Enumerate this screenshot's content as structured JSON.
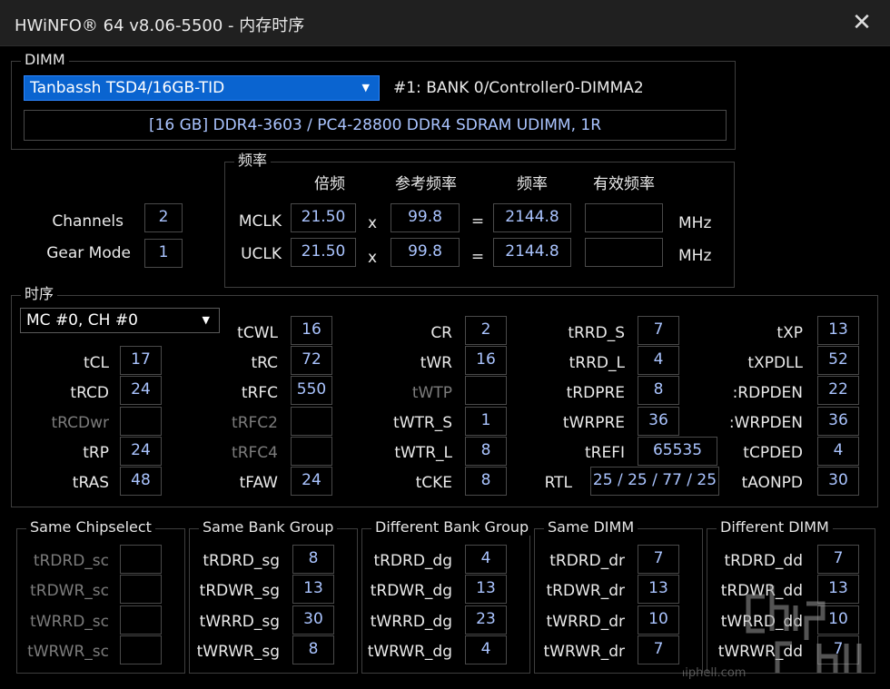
{
  "window": {
    "title": "HWiNFO® 64 v8.06-5500 - 内存时序"
  },
  "dimm": {
    "legend": "DIMM",
    "selected": "Tanbassh TSD4/16GB-TID",
    "location": "#1: BANK 0/Controller0-DIMMA2",
    "description": "[16 GB] DDR4-3603 / PC4-28800 DDR4 SDRAM UDIMM, 1R"
  },
  "freq": {
    "legend": "频率",
    "col_multiplier": "倍频",
    "col_ref": "参考频率",
    "col_freq": "频率",
    "col_effective": "有效频率",
    "times": "x",
    "equals": "=",
    "unit": "MHz",
    "rows": [
      {
        "label": "MCLK",
        "multiplier": "21.50",
        "ref": "99.8",
        "freq": "2144.8",
        "effective": ""
      },
      {
        "label": "UCLK",
        "multiplier": "21.50",
        "ref": "99.8",
        "freq": "2144.8",
        "effective": ""
      }
    ]
  },
  "channels": {
    "label": "Channels",
    "value": "2"
  },
  "gear": {
    "label": "Gear Mode",
    "value": "1"
  },
  "timings": {
    "legend": "时序",
    "selector": "MC #0, CH #0",
    "tCL": "17",
    "tRCD": "24",
    "tRCDwr": "",
    "tRP": "24",
    "tRAS": "48",
    "tCWL": "16",
    "tRC": "72",
    "tRFC": "550",
    "tRFC2": "",
    "tRFC4": "",
    "tFAW": "24",
    "CR": "2",
    "tWR": "16",
    "tWTP": "",
    "tWTR_S": "1",
    "tWTR_L": "8",
    "tCKE": "8",
    "tRRD_S": "7",
    "tRRD_L": "4",
    "tRDPRE": "8",
    "tWRPRE": "36",
    "tREFI": "65535",
    "RTL": "25 / 25 / 77 / 25",
    "tXP": "13",
    "tXPDLL": "52",
    "tRDPDEN": "22",
    "tWRPDEN": "36",
    "tCPDED": "4",
    "tAONPD": "30",
    "tRDPDEN_label": ":RDPDEN",
    "tWRPDEN_label": ":WRPDEN"
  },
  "turnaround": {
    "same_chipselect": {
      "legend": "Same Chipselect",
      "tRDRD_sc": "",
      "tRDWR_sc": "",
      "tWRRD_sc": "",
      "tWRWR_sc": ""
    },
    "same_bank_group": {
      "legend": "Same Bank Group",
      "tRDRD_sg": "8",
      "tRDWR_sg": "13",
      "tWRRD_sg": "30",
      "tWRWR_sg": "8"
    },
    "different_bank_group": {
      "legend": "Different Bank Group",
      "tRDRD_dg": "4",
      "tRDWR_dg": "13",
      "tWRRD_dg": "23",
      "tWRWR_dg": "4"
    },
    "same_dimm": {
      "legend": "Same DIMM",
      "tRDRD_dr": "7",
      "tRDWR_dr": "13",
      "tWRRD_dr": "10",
      "tWRWR_dr": "7"
    },
    "different_dimm": {
      "legend": "Different DIMM",
      "tRDRD_dd": "7",
      "tRDWR_dd": "13",
      "tWRRD_dd": "10",
      "tWRWR_dd": "7"
    }
  },
  "watermark": {
    "text": "www.chiphell.com"
  }
}
